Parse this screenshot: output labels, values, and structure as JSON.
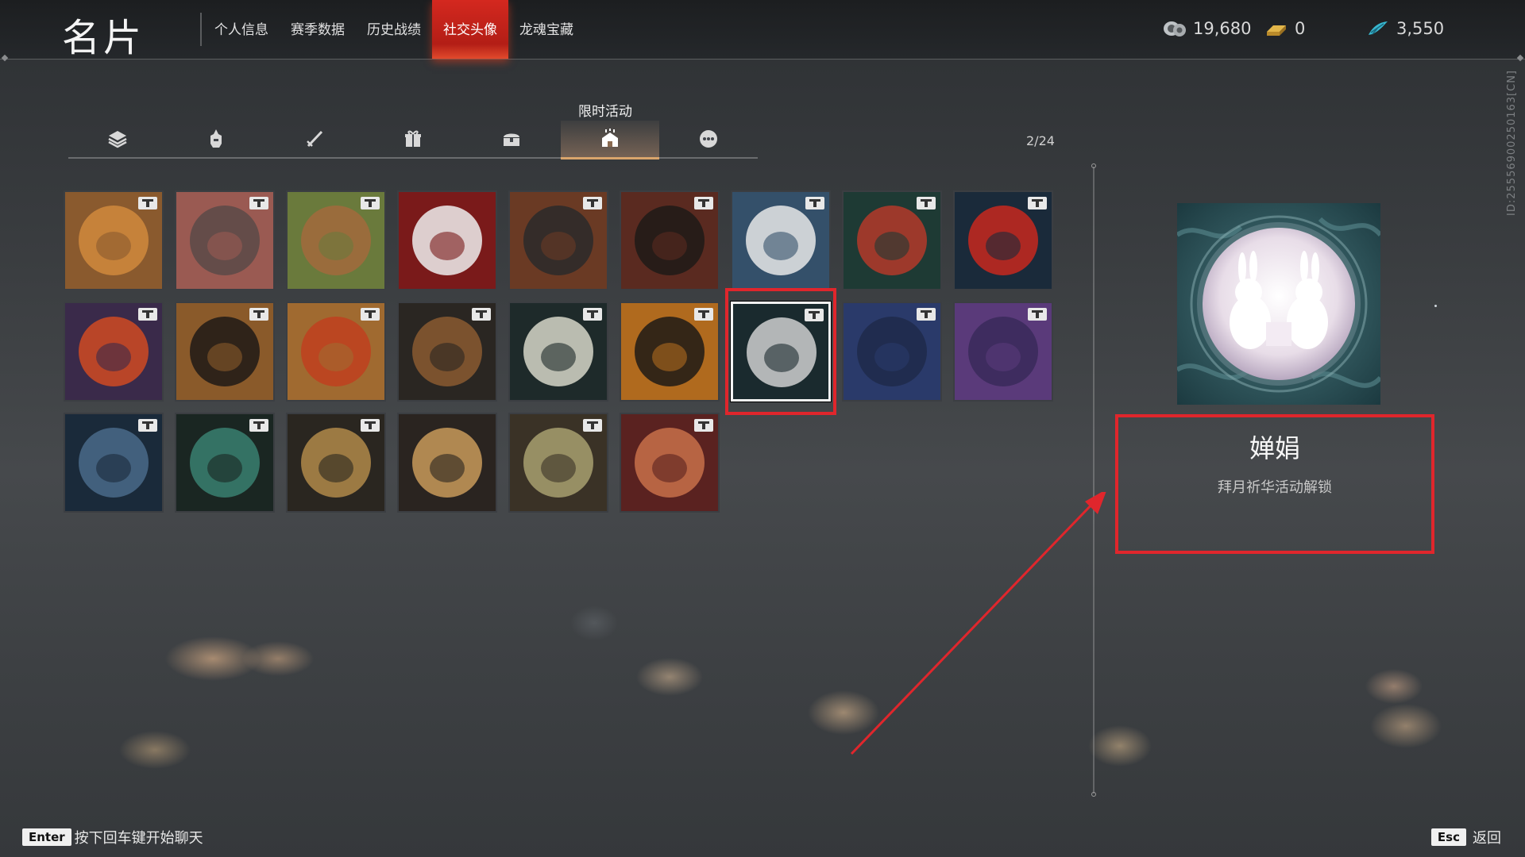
{
  "header": {
    "title": "名片",
    "nav": [
      {
        "label": "个人信息",
        "active": false
      },
      {
        "label": "赛季数据",
        "active": false
      },
      {
        "label": "历史战绩",
        "active": false
      },
      {
        "label": "社交头像",
        "active": true
      },
      {
        "label": "龙魂宝藏",
        "active": false
      }
    ],
    "currencies": [
      {
        "icon": "coin-stack-icon",
        "value": "19,680"
      },
      {
        "icon": "gold-bar-icon",
        "value": "0"
      },
      {
        "icon": "jade-feather-icon",
        "value": "3,550"
      }
    ]
  },
  "tabs": {
    "tooltip": "限时活动",
    "items": [
      {
        "icon": "layers-icon",
        "active": false
      },
      {
        "icon": "warrior-helmet-icon",
        "active": false
      },
      {
        "icon": "sword-icon",
        "active": false
      },
      {
        "icon": "gift-box-icon",
        "active": false
      },
      {
        "icon": "treasure-chest-icon",
        "active": false
      },
      {
        "icon": "event-tent-icon",
        "active": true
      },
      {
        "icon": "more-icon",
        "active": false
      }
    ],
    "count": "2/24"
  },
  "avatars": [
    {
      "name": "shiba-avatar",
      "bg": "#8a5a2e",
      "fg": "#d08a3c",
      "locked": true
    },
    {
      "name": "cat-avatar",
      "bg": "#9a5a52",
      "fg": "#5a4a48",
      "locked": true
    },
    {
      "name": "otter-avatar",
      "bg": "#6a7a3c",
      "fg": "#a26a3c",
      "locked": true
    },
    {
      "name": "plum-blossom-avatar",
      "bg": "#7a1a1a",
      "fg": "#eeeeee",
      "locked": false
    },
    {
      "name": "female-warrior-avatar",
      "bg": "#6a3a24",
      "fg": "#2a2a2a",
      "locked": true
    },
    {
      "name": "male-warrior-avatar",
      "bg": "#5a2a20",
      "fg": "#1e1a18",
      "locked": true
    },
    {
      "name": "masked-face-avatar",
      "bg": "#34506a",
      "fg": "#e8e8e8",
      "locked": true
    },
    {
      "name": "bell-wreath-avatar",
      "bg": "#1e3a34",
      "fg": "#b43a2a",
      "locked": true
    },
    {
      "name": "red-claw-avatar",
      "bg": "#1a2a3a",
      "fg": "#c8281e",
      "locked": true
    },
    {
      "name": "red-dragon-avatar",
      "bg": "#3a2a4a",
      "fg": "#d04a22",
      "locked": true
    },
    {
      "name": "flame-warrior-avatar",
      "bg": "#8a5a2a",
      "fg": "#1e1a16",
      "locked": true
    },
    {
      "name": "flame-fish-avatar",
      "bg": "#a06a30",
      "fg": "#c0401e",
      "locked": true
    },
    {
      "name": "gold-fish-emblem-avatar",
      "bg": "#2a2622",
      "fg": "#8a5a30",
      "locked": true
    },
    {
      "name": "fish-shield-avatar",
      "bg": "#1e2a2a",
      "fg": "#d6d6c8",
      "locked": true
    },
    {
      "name": "dragon-silhouette-avatar",
      "bg": "#b06a1e",
      "fg": "#1e1a16",
      "locked": true
    },
    {
      "name": "rabbits-moon-avatar",
      "bg": "#1a2a2e",
      "fg": "#cfcfcf",
      "locked": true,
      "selected": true
    },
    {
      "name": "blue-lady-avatar",
      "bg": "#2a3a6a",
      "fg": "#1e2a4a",
      "locked": true
    },
    {
      "name": "purple-lady-avatar",
      "bg": "#5a3a7a",
      "fg": "#3a2a5a",
      "locked": true
    },
    {
      "name": "blue-lotus-avatar",
      "bg": "#1a2a3a",
      "fg": "#4a6a8a",
      "locked": true
    },
    {
      "name": "teal-lotus-avatar",
      "bg": "#1a2622",
      "fg": "#3a8070",
      "locked": true
    },
    {
      "name": "gold-lotus-avatar",
      "bg": "#2a2620",
      "fg": "#b08a4a",
      "locked": true
    },
    {
      "name": "spear-emblem-avatar",
      "bg": "#2a2420",
      "fg": "#c89a5a",
      "locked": false
    },
    {
      "name": "lantern-robe-avatar",
      "bg": "#3a3226",
      "fg": "#a8a070",
      "locked": true
    },
    {
      "name": "red-fish-avatar",
      "bg": "#5a2220",
      "fg": "#c8704a",
      "locked": true
    }
  ],
  "detail": {
    "name": "婵娟",
    "desc": "拜月祈华活动解锁",
    "preview_icon": "rabbits-moon-icon"
  },
  "side_id": "ID:2555690025016​3[CN]",
  "footer": {
    "enter_key": "Enter",
    "enter_hint": "按下回车键开始聊天",
    "esc_key": "Esc",
    "esc_hint": "返回"
  },
  "colors": {
    "accent_red": "#e0262c",
    "tab_active": "#d9a56c"
  }
}
